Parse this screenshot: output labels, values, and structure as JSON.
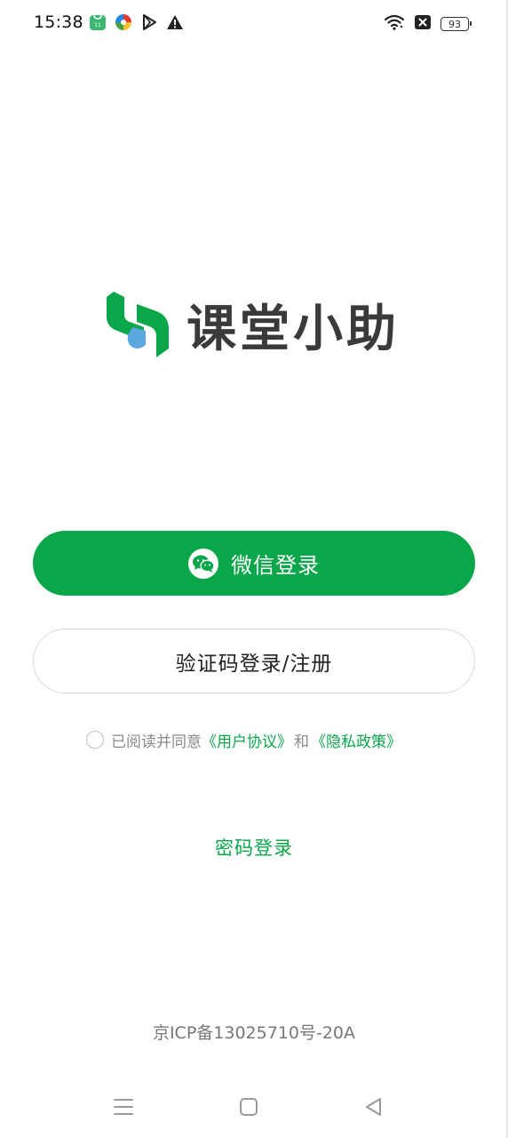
{
  "status_bar": {
    "time": "15:38",
    "battery": "93",
    "left_icons": [
      "app-store-icon",
      "colorful-app-icon",
      "play-icon",
      "warning-icon"
    ],
    "right_icons": [
      "wifi-icon",
      "close-box-icon",
      "battery-icon"
    ]
  },
  "brand": {
    "name": "课堂小助",
    "primary_color": "#0aa64a",
    "secondary_color": "#5ba7e0"
  },
  "buttons": {
    "wechat_login": "微信登录",
    "code_login": "验证码登录/注册"
  },
  "agreement": {
    "prefix": "已阅读并同意",
    "user_agreement": "《用户协议》",
    "and": "和",
    "privacy_policy": "《隐私政策》"
  },
  "password_login": "密码登录",
  "footer": {
    "icp": "京ICP备13025710号-20A"
  },
  "nav_bar": {
    "icons": [
      "menu-icon",
      "home-square-icon",
      "back-triangle-icon"
    ]
  }
}
